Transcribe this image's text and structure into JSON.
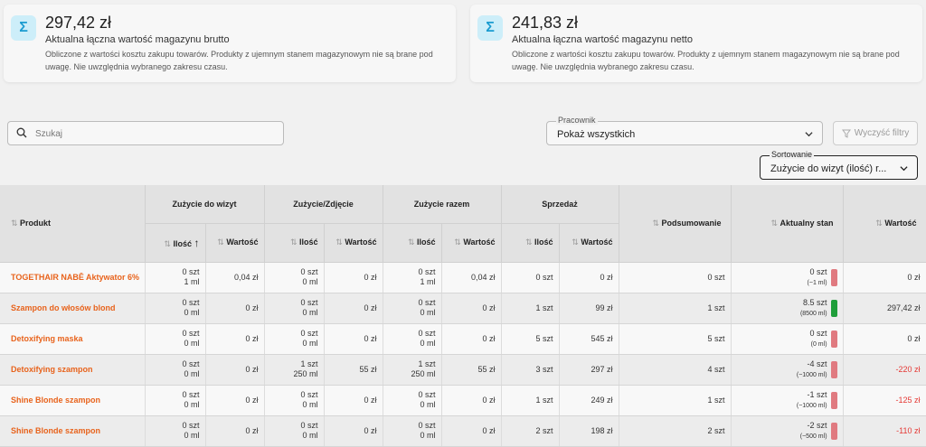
{
  "cards": [
    {
      "amount": "297,42 zł",
      "title": "Aktualna łączna wartość magazynu brutto",
      "desc": "Obliczone z wartości kosztu zakupu towarów. Produkty z ujemnym stanem magazynowym nie są brane pod uwagę. Nie uwzględnia wybranego zakresu czasu.",
      "icon": "sigma-icon"
    },
    {
      "amount": "241,83 zł",
      "title": "Aktualna łączna wartość magazynu netto",
      "desc": "Obliczone z wartości kosztu zakupu towarów. Produkty z ujemnym stanem magazynowym nie są brane pod uwagę. Nie uwzględnia wybranego zakresu czasu.",
      "icon": "sigma-icon"
    }
  ],
  "filters": {
    "search_placeholder": "Szukaj",
    "pracownik_label": "Pracownik",
    "pracownik_value": "Pokaż wszystkich",
    "clear_label": "Wyczyść filtry",
    "sort_label": "Sortowanie",
    "sort_value": "Zużycie do wizyt (ilość) r..."
  },
  "table": {
    "headers": {
      "produkt": "Produkt",
      "zuzycie_wizyt": "Zużycie do wizyt",
      "zuzycie_zdjecie": "Zużycie/Zdjęcie",
      "zuzycie_razem": "Zużycie razem",
      "sprzedaz": "Sprzedaż",
      "podsumowanie": "Podsumowanie",
      "aktualny_stan": "Aktualny stan",
      "wartosc": "Wartość",
      "ilosc": "Ilość",
      "sub_wartosc": "Wartość"
    },
    "rows": [
      {
        "name": "TOGETHAIR NABĒ Aktywator 6%",
        "w_q": "0 szt",
        "w_q2": "1 ml",
        "w_v": "0,04 zł",
        "z_q": "0 szt",
        "z_q2": "0 ml",
        "z_v": "0 zł",
        "r_q": "0 szt",
        "r_q2": "1 ml",
        "r_v": "0,04 zł",
        "s_q": "0 szt",
        "s_v": "0 zł",
        "pods": "0 szt",
        "stan": "0 szt",
        "stan2": "(~1 ml)",
        "stan_color": "#e07a80",
        "val": "0 zł",
        "neg": false
      },
      {
        "name": "Szampon do włosów blond",
        "w_q": "0 szt",
        "w_q2": "0 ml",
        "w_v": "0 zł",
        "z_q": "0 szt",
        "z_q2": "0 ml",
        "z_v": "0 zł",
        "r_q": "0 szt",
        "r_q2": "0 ml",
        "r_v": "0 zł",
        "s_q": "1 szt",
        "s_v": "99 zł",
        "pods": "1 szt",
        "stan": "8.5 szt",
        "stan2": "(8500 ml)",
        "stan_color": "#1f9e3a",
        "val": "297,42 zł",
        "neg": false
      },
      {
        "name": "Detoxifying maska",
        "w_q": "0 szt",
        "w_q2": "0 ml",
        "w_v": "0 zł",
        "z_q": "0 szt",
        "z_q2": "0 ml",
        "z_v": "0 zł",
        "r_q": "0 szt",
        "r_q2": "0 ml",
        "r_v": "0 zł",
        "s_q": "5 szt",
        "s_v": "545 zł",
        "pods": "5 szt",
        "stan": "0 szt",
        "stan2": "(0 ml)",
        "stan_color": "#e07a80",
        "val": "0 zł",
        "neg": false
      },
      {
        "name": "Detoxifying szampon",
        "w_q": "0 szt",
        "w_q2": "0 ml",
        "w_v": "0 zł",
        "z_q": "1 szt",
        "z_q2": "250 ml",
        "z_v": "55 zł",
        "r_q": "1 szt",
        "r_q2": "250 ml",
        "r_v": "55 zł",
        "s_q": "3 szt",
        "s_v": "297 zł",
        "pods": "4 szt",
        "stan": "-4 szt",
        "stan2": "(~1000 ml)",
        "stan_color": "#e07a80",
        "val": "-220 zł",
        "neg": true
      },
      {
        "name": "Shine Blonde szampon",
        "w_q": "0 szt",
        "w_q2": "0 ml",
        "w_v": "0 zł",
        "z_q": "0 szt",
        "z_q2": "0 ml",
        "z_v": "0 zł",
        "r_q": "0 szt",
        "r_q2": "0 ml",
        "r_v": "0 zł",
        "s_q": "1 szt",
        "s_v": "249 zł",
        "pods": "1 szt",
        "stan": "-1 szt",
        "stan2": "(~1000 ml)",
        "stan_color": "#e07a80",
        "val": "-125 zł",
        "neg": true
      },
      {
        "name": "Shine Blonde szampon",
        "w_q": "0 szt",
        "w_q2": "0 ml",
        "w_v": "0 zł",
        "z_q": "0 szt",
        "z_q2": "0 ml",
        "z_v": "0 zł",
        "r_q": "0 szt",
        "r_q2": "0 ml",
        "r_v": "0 zł",
        "s_q": "2 szt",
        "s_v": "198 zł",
        "pods": "2 szt",
        "stan": "-2 szt",
        "stan2": "(~500 ml)",
        "stan_color": "#e07a80",
        "val": "-110 zł",
        "neg": true
      }
    ]
  }
}
